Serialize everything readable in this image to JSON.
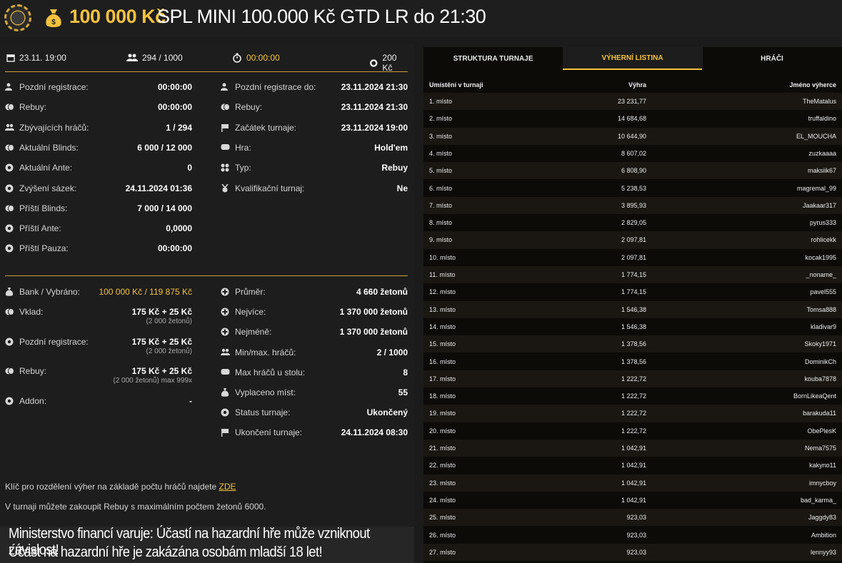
{
  "header": {
    "prize": "100 000 Kč",
    "title": "SPL MINI 100.000 Kč GTD LR do 21:30",
    "accent": "#f3c23d"
  },
  "topbar": {
    "date": "23.11. 19:00",
    "players": "294 / 1000",
    "timer": "00:00:00",
    "buyin": "200 Kč"
  },
  "info_left": [
    {
      "icon": "user-clock-icon",
      "label": "Pozdní registrace:",
      "value": "00:00:00"
    },
    {
      "icon": "coins-icon",
      "label": "Rebuy:",
      "value": "00:00:00"
    },
    {
      "icon": "users-icon",
      "label": "Zbývajících hráčů:",
      "value": "1 / 294"
    },
    {
      "icon": "coins-icon",
      "label": "Aktuální Blinds:",
      "value": "6 000 / 12 000"
    },
    {
      "icon": "chip-icon",
      "label": "Aktuální Ante:",
      "value": "0"
    },
    {
      "icon": "level-up-icon",
      "label": "Zvýšení sázek:",
      "value": "24.11.2024 01:36"
    },
    {
      "icon": "coins-icon",
      "label": "Příští Blinds:",
      "value": "7 000 / 14 000"
    },
    {
      "icon": "chip-icon",
      "label": "Příští Ante:",
      "value": "0,0000"
    },
    {
      "icon": "clock-icon",
      "label": "Příští Pauza:",
      "value": "00:00:00"
    }
  ],
  "info_right": [
    {
      "icon": "user-clock-icon",
      "label": "Pozdní registrace do:",
      "value": "23.11.2024 21:30"
    },
    {
      "icon": "coins-icon",
      "label": "Rebuy:",
      "value": "23.11.2024 21:30"
    },
    {
      "icon": "flag-icon",
      "label": "Začátek turnaje:",
      "value": "23.11.2024 19:00"
    },
    {
      "icon": "cards-icon",
      "label": "Hra:",
      "value": "Hold'em"
    },
    {
      "icon": "suits-icon",
      "label": "Typ:",
      "value": "Rebuy"
    },
    {
      "icon": "medal-icon",
      "label": "Kvalifikační turnaj:",
      "value": "Ne"
    }
  ],
  "money_left": [
    {
      "icon": "moneybag-icon",
      "label": "Bank / Vybráno:",
      "value": "100 000 Kč / 119 875 Kč",
      "sub": ""
    },
    {
      "icon": "coins-icon",
      "label": "Vklad:",
      "value": "175 Kč + 25 Kč",
      "sub": "(2 000 žetonů)"
    },
    {
      "icon": "chip-icon",
      "label": "Pozdní registrace:",
      "value": "175 Kč + 25 Kč",
      "sub": "(2 000 žetonů)"
    },
    {
      "icon": "coins-icon",
      "label": "Rebuy:",
      "value": "175 Kč + 25 Kč",
      "sub": "(2 000 žetonů) max 999x"
    },
    {
      "icon": "chip-icon",
      "label": "Addon:",
      "value": "-",
      "sub": ""
    }
  ],
  "money_right": [
    {
      "icon": "plus-circle-icon",
      "label": "Průměr:",
      "value": "4 660 žetonů"
    },
    {
      "icon": "plus-circle-icon",
      "label": "Nejvíce:",
      "value": "1 370 000 žetonů"
    },
    {
      "icon": "plus-circle-icon",
      "label": "Nejméně:",
      "value": "1 370 000 žetonů"
    },
    {
      "icon": "users-icon",
      "label": "Min/max. hráčů:",
      "value": "2 / 1000"
    },
    {
      "icon": "table-icon",
      "label": "Max hráčů u stolu:",
      "value": "8"
    },
    {
      "icon": "payout-icon",
      "label": "Vyplaceno míst:",
      "value": "55"
    },
    {
      "icon": "status-icon",
      "label": "Status turnaje:",
      "value": "Ukončený"
    },
    {
      "icon": "flag-icon",
      "label": "Ukončení turnaje:",
      "value": "24.11.2024 08:30"
    }
  ],
  "notes": {
    "key_text": "Klíč pro rozdělení výher na základě počtu hráčů najdete ",
    "key_link": "ZDE",
    "rebuy_text": "V turnaji můžete zakoupit Rebuy s maximálním počtem žetonů 6000."
  },
  "warning": {
    "line1": "Ministerstvo financí varuje: Účastí na hazardní hře může vzniknout závislost!",
    "line2": "Účast na hazardní hře je zakázána osobám mladší 18 let!"
  },
  "tabs": [
    {
      "label": "STRUKTURA TURNAJE"
    },
    {
      "label": "VÝHERNÍ LISTINA"
    },
    {
      "label": "HRÁČI"
    }
  ],
  "table": {
    "headers": [
      "Umístění v turnaji",
      "Výhra",
      "Jméno výherce"
    ],
    "rows": [
      [
        "1. místo",
        "23 231,77",
        "TheMatalus"
      ],
      [
        "2. místo",
        "14 684,68",
        "truffaldino"
      ],
      [
        "3. místo",
        "10 644,90",
        "EL_MOUCHA"
      ],
      [
        "4. místo",
        "8 607,02",
        "zuzkaaaa"
      ],
      [
        "5. místo",
        "6 808,90",
        "maksiik67"
      ],
      [
        "6. místo",
        "5 238,53",
        "magremal_99"
      ],
      [
        "7. místo",
        "3 895,93",
        "Jaakaar317"
      ],
      [
        "8. místo",
        "2 829,05",
        "pyrus333"
      ],
      [
        "9. místo",
        "2 097,81",
        "rohlicekk"
      ],
      [
        "10. místo",
        "2 097,81",
        "kocak1995"
      ],
      [
        "11. místo",
        "1 774,15",
        "_noname_"
      ],
      [
        "12. místo",
        "1 774,15",
        "pavel555"
      ],
      [
        "13. místo",
        "1 546,38",
        "Tomsa888"
      ],
      [
        "14. místo",
        "1 546,38",
        "kladivar9"
      ],
      [
        "15. místo",
        "1 378,56",
        "Skoky1971"
      ],
      [
        "16. místo",
        "1 378,56",
        "DominikCh"
      ],
      [
        "17. místo",
        "1 222,72",
        "kouba7878"
      ],
      [
        "18. místo",
        "1 222,72",
        "BornLikeaQent"
      ],
      [
        "19. místo",
        "1 222,72",
        "barakuda11"
      ],
      [
        "20. místo",
        "1 222,72",
        "ObePlesK"
      ],
      [
        "21. místo",
        "1 042,91",
        "Nema7575"
      ],
      [
        "22. místo",
        "1 042,91",
        "kakyno11"
      ],
      [
        "23. místo",
        "1 042,91",
        "imnycboy"
      ],
      [
        "24. místo",
        "1 042,91",
        "bad_karma_"
      ],
      [
        "25. místo",
        "923,03",
        "Jaggdy83"
      ],
      [
        "26. místo",
        "923,03",
        "Ambition"
      ],
      [
        "27. místo",
        "923,03",
        "lennyy93"
      ]
    ]
  }
}
